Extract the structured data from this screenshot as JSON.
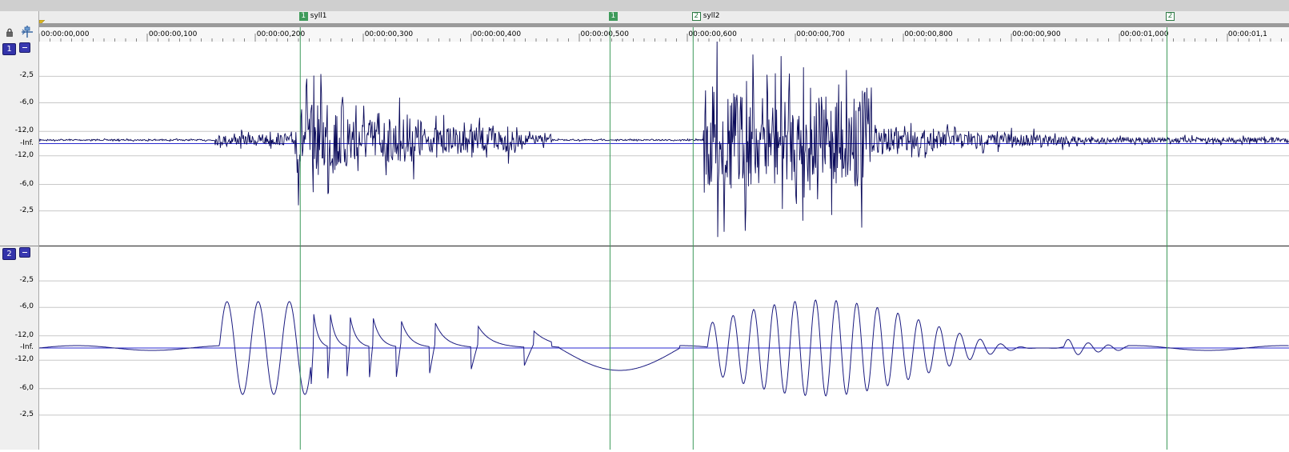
{
  "toolbar": {
    "lock_icon": "lock-icon",
    "snap_icon": "snap-to-marker-icon"
  },
  "timeline": {
    "unit": "time",
    "ticks": [
      {
        "label": "00:00:00,000",
        "t": 0.0
      },
      {
        "label": "00:00:00,100",
        "t": 0.1
      },
      {
        "label": "00:00:00,200",
        "t": 0.2
      },
      {
        "label": "00:00:00,300",
        "t": 0.3
      },
      {
        "label": "00:00:00,400",
        "t": 0.4
      },
      {
        "label": "00:00:00,500",
        "t": 0.5
      },
      {
        "label": "00:00:00,600",
        "t": 0.6
      },
      {
        "label": "00:00:00,700",
        "t": 0.7
      },
      {
        "label": "00:00:00,800",
        "t": 0.8
      },
      {
        "label": "00:00:00,900",
        "t": 0.9
      },
      {
        "label": "00:00:01,000",
        "t": 1.0
      },
      {
        "label": "00:00:01,1",
        "t": 1.1
      }
    ]
  },
  "markers": [
    {
      "id": "1",
      "name": "syll1",
      "style": "filled",
      "t": 0.24
    },
    {
      "id": "1",
      "name": "",
      "style": "filled",
      "t": 0.527
    },
    {
      "id": "2",
      "name": "syll2",
      "style": "hollow",
      "t": 0.604
    },
    {
      "id": "2",
      "name": "",
      "style": "hollow",
      "t": 1.043
    }
  ],
  "tracks": [
    {
      "number": "1",
      "db_labels": [
        "-2,5",
        "-6,0",
        "-12,0",
        "-Inf.",
        "-12,0",
        "-6,0",
        "-2,5"
      ],
      "kind": "audio"
    },
    {
      "number": "2",
      "db_labels": [
        "-2,5",
        "-6,0",
        "-12,0",
        "-Inf.",
        "-12,0",
        "-6,0",
        "-2,5"
      ],
      "kind": "glottal"
    }
  ],
  "colors": {
    "waveform": "#0a0a5a",
    "waveform_track2": "#1a1a80",
    "marker_line": "#3c9a5a",
    "grid": "#c8c8c8",
    "zero_line": "#2a2ad0",
    "accent_badge": "#3333aa"
  }
}
